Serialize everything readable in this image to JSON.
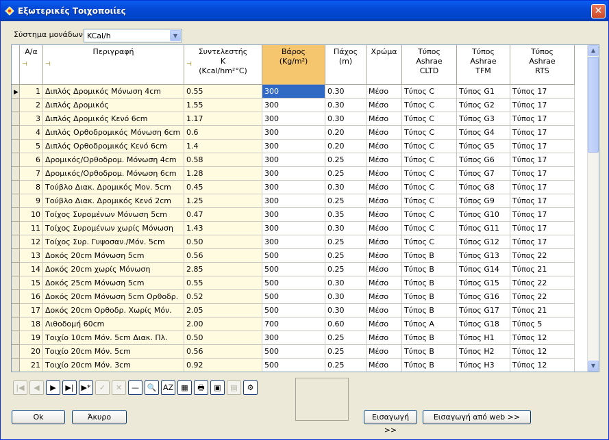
{
  "window": {
    "title": "Εξωτερικές Τοιχοποιίες",
    "close": "✕"
  },
  "units": {
    "label": "Σύστημα μονάδων",
    "value": "KCal/h"
  },
  "columns": [
    {
      "label": "Α/α",
      "pin": true
    },
    {
      "label": "Περιγραφή",
      "pin": true
    },
    {
      "label": "Συντελεστής\nK\n(Kcal/hm²°C)",
      "pin": true
    },
    {
      "label": "Βάρος\n(Kg/m²)",
      "pin": false
    },
    {
      "label": "Πάχος\n(m)",
      "pin": false
    },
    {
      "label": "Χρώμα",
      "pin": false
    },
    {
      "label": "Τύπος\nAshrae\nCLTD",
      "pin": false
    },
    {
      "label": "Τύπος\nAshrae\nTFM",
      "pin": false
    },
    {
      "label": "Τύπος\nAshrae\nRTS",
      "pin": false
    }
  ],
  "rows": [
    [
      "1",
      "Διπλός Δρομικός Μόνωση 4cm",
      "0.55",
      "300",
      "0.30",
      "Μέσο",
      "Τύπος C",
      "Τύπος G1",
      "Τύπος 17"
    ],
    [
      "2",
      "Διπλός Δρομικός",
      "1.55",
      "300",
      "0.30",
      "Μέσο",
      "Τύπος C",
      "Τύπος G2",
      "Τύπος 17"
    ],
    [
      "3",
      "Διπλός Δρομικός Κενό 6cm",
      "1.17",
      "300",
      "0.30",
      "Μέσο",
      "Τύπος C",
      "Τύπος G3",
      "Τύπος 17"
    ],
    [
      "4",
      "Διπλός Ορθοδρομικός Μόνωση 6cm",
      "0.6",
      "300",
      "0.20",
      "Μέσο",
      "Τύπος C",
      "Τύπος G4",
      "Τύπος 17"
    ],
    [
      "5",
      "Διπλός Ορθοδρομικός Κενό 6cm",
      "1.4",
      "300",
      "0.20",
      "Μέσο",
      "Τύπος C",
      "Τύπος G5",
      "Τύπος 17"
    ],
    [
      "6",
      "Δρομικός/Ορθοδρομ. Μόνωση 4cm",
      "0.58",
      "300",
      "0.25",
      "Μέσο",
      "Τύπος C",
      "Τύπος G6",
      "Τύπος 17"
    ],
    [
      "7",
      "Δρομικός/Ορθοδρομ. Μόνωση 6cm",
      "1.28",
      "300",
      "0.25",
      "Μέσο",
      "Τύπος C",
      "Τύπος G7",
      "Τύπος 17"
    ],
    [
      "8",
      "Τούβλο Διακ. Δρομικός Μον. 5cm",
      "0.45",
      "300",
      "0.30",
      "Μέσο",
      "Τύπος C",
      "Τύπος G8",
      "Τύπος 17"
    ],
    [
      "9",
      "Τούβλο Διακ. Δρομικός Κενό 2cm",
      "1.25",
      "300",
      "0.25",
      "Μέσο",
      "Τύπος C",
      "Τύπος G9",
      "Τύπος 17"
    ],
    [
      "10",
      "Τοίχος Συρομένων Μόνωση 5cm",
      "0.47",
      "300",
      "0.35",
      "Μέσο",
      "Τύπος C",
      "Τύπος G10",
      "Τύπος 17"
    ],
    [
      "11",
      "Τοίχος Συρομένων χωρίς Μόνωση",
      "1.43",
      "300",
      "0.30",
      "Μέσο",
      "Τύπος C",
      "Τύπος G11",
      "Τύπος 17"
    ],
    [
      "12",
      "Τοίχος Συρ. Γυψοσαν./Μόν. 5cm",
      "0.50",
      "300",
      "0.25",
      "Μέσο",
      "Τύπος C",
      "Τύπος G12",
      "Τύπος 17"
    ],
    [
      "13",
      "Δοκός 20cm Μόνωση 5cm",
      "0.56",
      "500",
      "0.25",
      "Μέσο",
      "Τύπος B",
      "Τύπος G13",
      "Τύπος 22"
    ],
    [
      "14",
      "Δοκός 20cm χωρίς Μόνωση",
      "2.85",
      "500",
      "0.25",
      "Μέσο",
      "Τύπος B",
      "Τύπος G14",
      "Τύπος 21"
    ],
    [
      "15",
      "Δοκός 25cm Μόνωση 5cm",
      "0.55",
      "500",
      "0.30",
      "Μέσο",
      "Τύπος B",
      "Τύπος G15",
      "Τύπος 22"
    ],
    [
      "16",
      "Δοκός 20cm Μόνωση 5cm Ορθοδρ.",
      "0.52",
      "500",
      "0.30",
      "Μέσο",
      "Τύπος B",
      "Τύπος G16",
      "Τύπος 22"
    ],
    [
      "17",
      "Δοκός 20cm Ορθοδρ. Χωρίς Μόν.",
      "2.05",
      "500",
      "0.30",
      "Μέσο",
      "Τύπος B",
      "Τύπος G17",
      "Τύπος 21"
    ],
    [
      "18",
      "Λιθοδομή 60cm",
      "2.00",
      "700",
      "0.60",
      "Μέσο",
      "Τύπος A",
      "Τύπος G18",
      "Τύπος 5"
    ],
    [
      "19",
      "Τοιχίο 10cm Μόν. 5cm Διακ. Πλ.",
      "0.50",
      "300",
      "0.25",
      "Μέσο",
      "Τύπος B",
      "Τύπος H1",
      "Τύπος 12"
    ],
    [
      "20",
      "Τοιχίο 20cm Μόν. 5cm",
      "0.56",
      "500",
      "0.25",
      "Μέσο",
      "Τύπος B",
      "Τύπος H2",
      "Τύπος 12"
    ],
    [
      "21",
      "Τοιχίο 20cm Μόν. 3cm",
      "0.92",
      "500",
      "0.25",
      "Μέσο",
      "Τύπος B",
      "Τύπος H3",
      "Τύπος 12"
    ]
  ],
  "toolbar": {
    "first": "|◀",
    "prev": "◀",
    "next": "▶",
    "last": "▶|",
    "new": "▶*",
    "post": "✓",
    "cancel": "✕",
    "delete": "—",
    "find": "🔍",
    "sort": "AZ",
    "table": "▦",
    "print": "🖶",
    "export": "▣",
    "clear": "▤",
    "tool": "⚙"
  },
  "buttons": {
    "ok": "Ok",
    "cancel": "Άκυρο",
    "import": "Εισαγωγή >>",
    "import_web": "Εισαγωγή από web >>"
  },
  "colors": {
    "accent": "#316ac5",
    "selected_header": "#f6c66e",
    "pinned_column_bg": "#fffbe0"
  }
}
